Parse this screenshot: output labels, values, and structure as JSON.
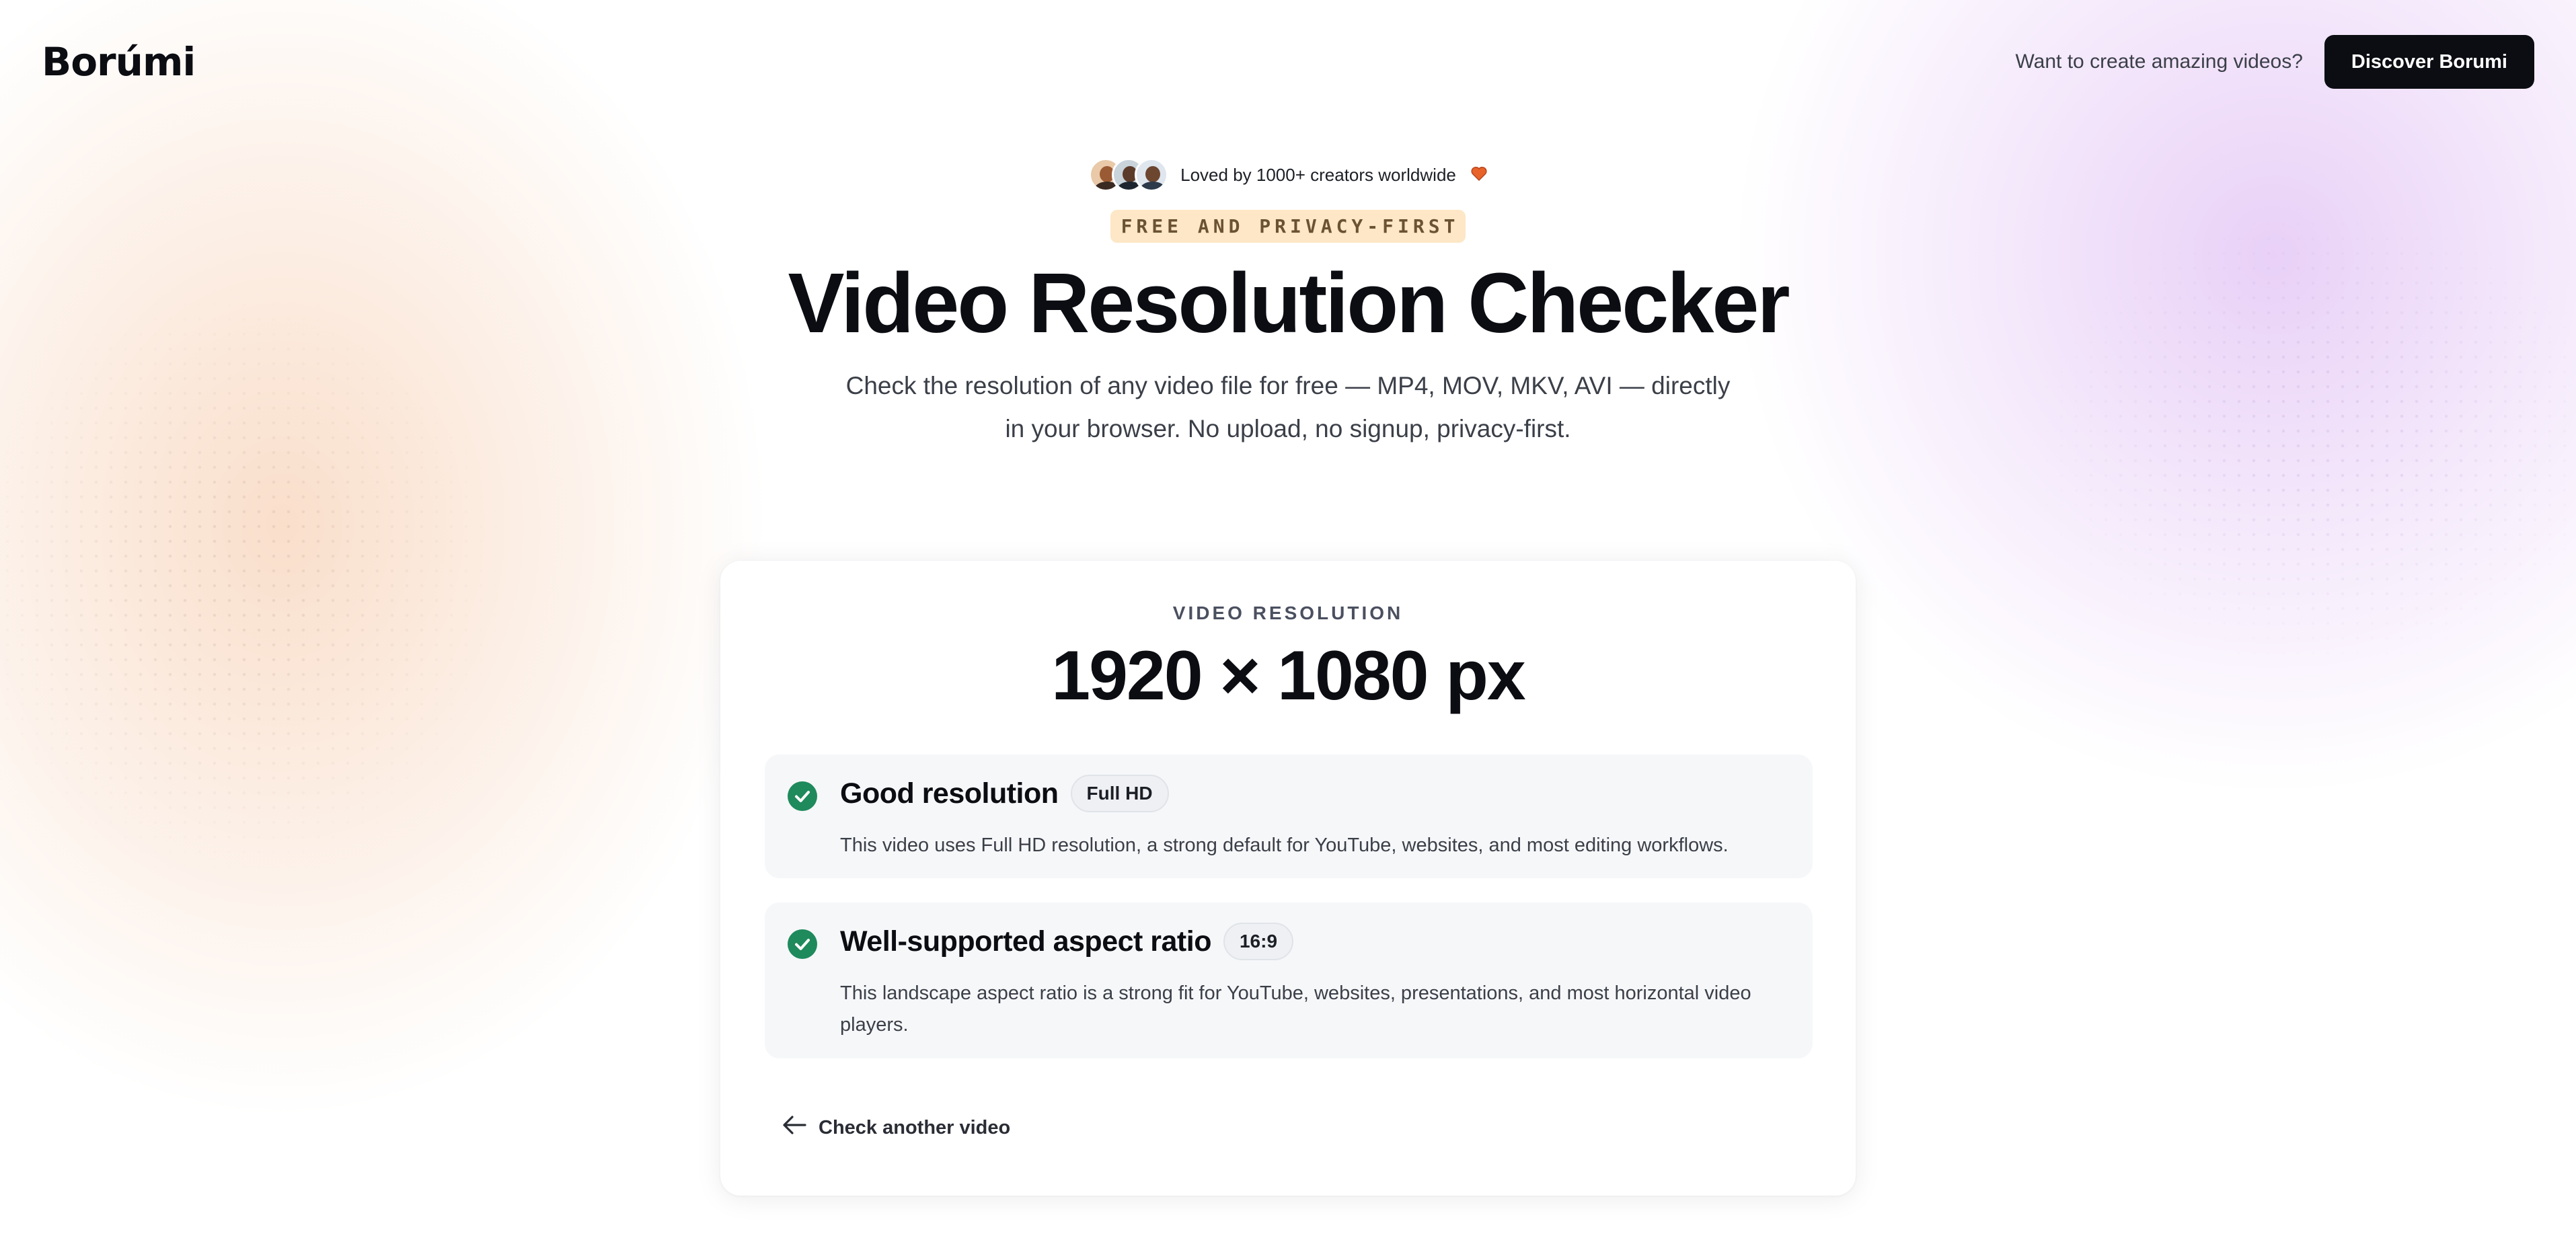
{
  "header": {
    "logo": "Borúmi",
    "prompt": "Want to create amazing videos?",
    "cta_label": "Discover Borumi"
  },
  "hero": {
    "social_proof": "Loved by 1000+ creators worldwide",
    "tagline": "FREE AND PRIVACY-FIRST",
    "title": "Video Resolution Checker",
    "subtitle": "Check the resolution of any video file for free — MP4, MOV, MKV, AVI — directly in your browser. No upload, no signup, privacy-first."
  },
  "result": {
    "eyebrow": "VIDEO RESOLUTION",
    "resolution": "1920 × 1080 px",
    "checks": [
      {
        "title": "Good resolution",
        "badge": "Full HD",
        "description": "This video uses Full HD resolution, a strong default for YouTube, websites, and most editing workflows."
      },
      {
        "title": "Well-supported aspect ratio",
        "badge": "16:9",
        "description": "This landscape aspect ratio is a strong fit for YouTube, websites, presentations, and most horizontal video players."
      }
    ],
    "back_label": "Check another video"
  },
  "colors": {
    "brand_dark": "#0b0d12",
    "success": "#1f8a5c",
    "tag_bg": "#fde7c6",
    "glow_left": "#f5c4a0",
    "glow_right": "#d6aaf0"
  },
  "icons": [
    "heart-icon",
    "check-circle-icon",
    "arrow-left-icon"
  ]
}
